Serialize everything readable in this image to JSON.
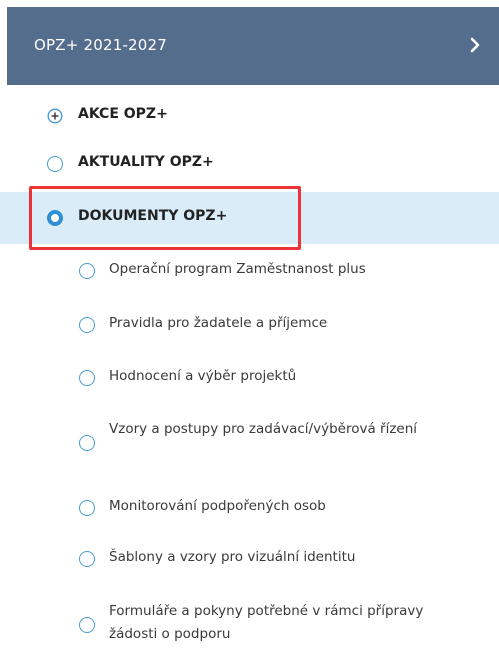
{
  "header": {
    "title": "OPZ+ 2021-2027",
    "chevron_icon": "chevron-right-icon"
  },
  "menu": {
    "items": [
      {
        "label": "AKCE OPZ+",
        "icon": "plus-circle-icon",
        "level": "top"
      },
      {
        "label": "AKTUALITY OPZ+",
        "icon": "radio-circle-icon",
        "level": "top"
      },
      {
        "label": "DOKUMENTY OPZ+",
        "icon": "radio-selected-icon",
        "level": "top",
        "active": true
      }
    ],
    "subitems": [
      {
        "label": "Operační program Zaměstnanost plus"
      },
      {
        "label": "Pravidla pro žadatele a příjemce"
      },
      {
        "label": "Hodnocení a výběr projektů"
      },
      {
        "label": "Vzory a postupy pro zadávací/výběrová řízení"
      },
      {
        "label": "Monitorování podpořených osob"
      },
      {
        "label": "Šablony a vzory pro vizuální identitu"
      },
      {
        "label": "Formuláře a pokyny potřebné v rámci přípravy žádosti o podporu"
      }
    ]
  },
  "colors": {
    "header_bg": "#556d8c",
    "active_bg": "#d9ecf8",
    "radio": "#4b9bd3",
    "highlight": "#ee3338"
  }
}
